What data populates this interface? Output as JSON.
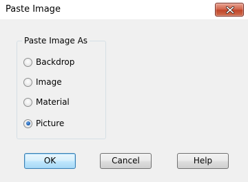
{
  "window": {
    "title": "Paste Image"
  },
  "group": {
    "label": "Paste Image As",
    "options": [
      {
        "label": "Backdrop",
        "selected": false
      },
      {
        "label": "Image",
        "selected": false
      },
      {
        "label": "Material",
        "selected": false
      },
      {
        "label": "Picture",
        "selected": true
      }
    ]
  },
  "buttons": {
    "ok_label": "OK",
    "cancel_label": "Cancel",
    "help_label": "Help"
  },
  "colors": {
    "dialog_background": "#f0f0f0",
    "close_button": "#c74a31",
    "default_button_border": "#3c7fb1"
  },
  "icons": {
    "close": "close-icon"
  }
}
